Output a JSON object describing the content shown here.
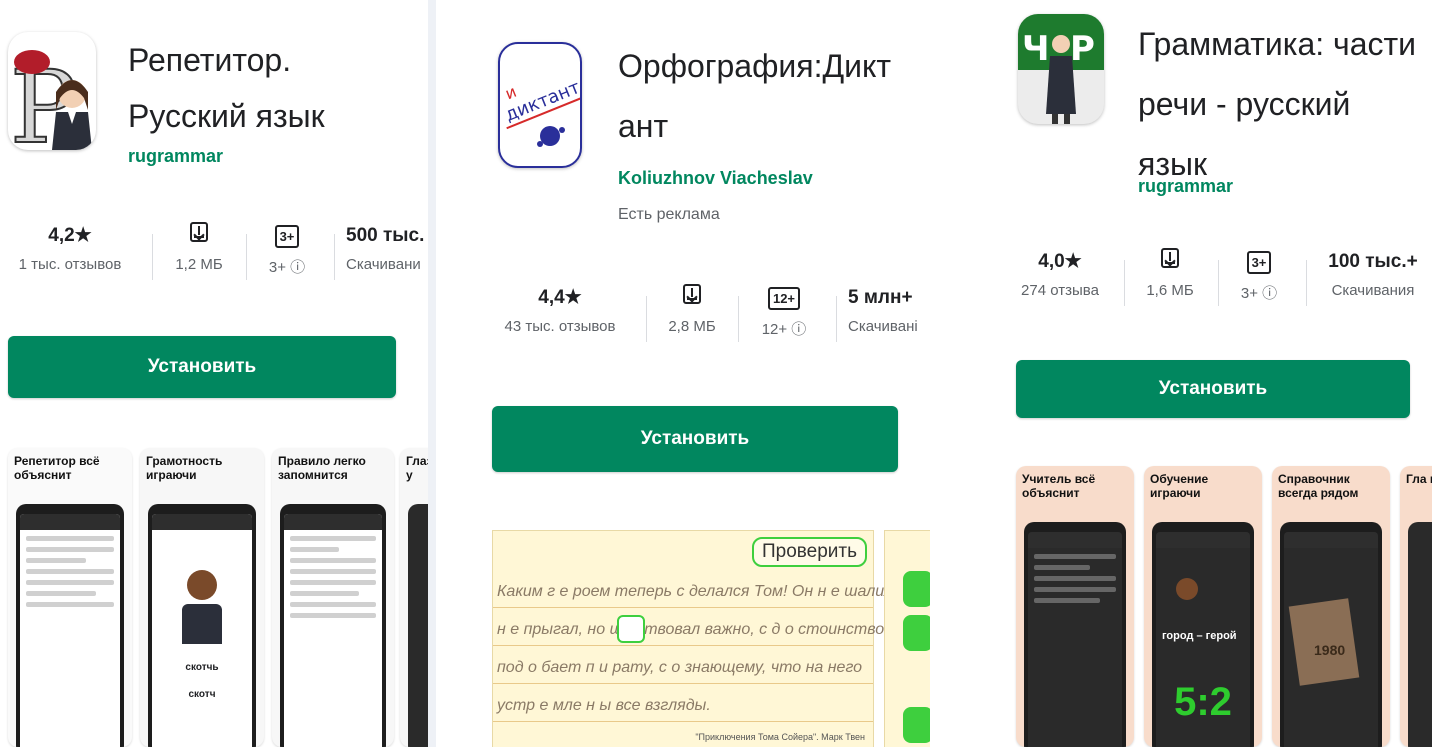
{
  "apps": [
    {
      "title_lines": [
        "Репетитор.",
        "Русский язык"
      ],
      "developer": "rugrammar",
      "rating": "4,2★",
      "reviews": "1 тыс. отзывов",
      "size": "1,2 МБ",
      "age_badge": "3+",
      "age": "3+ ⓘ",
      "downloads": "500 тыс.",
      "downloads_label": "Скачивани",
      "install_label": "Установить",
      "screenshots": [
        {
          "caption": "Репетитор всё объяснит"
        },
        {
          "caption": "Грамотность играючи"
        },
        {
          "caption": "Правило легко запомнится"
        },
        {
          "caption": "Глаз не у"
        }
      ],
      "shot_words": [
        "скотчь",
        "скотч"
      ]
    },
    {
      "title_lines": [
        "Орфография:Дикт",
        "ант"
      ],
      "developer": "Koliuzhnov Viacheslav",
      "ads_note": "Есть реклама",
      "rating": "4,4★",
      "reviews": "43 тыс. отзывов",
      "size": "2,8 МБ",
      "age_badge": "12+",
      "age": "12+ ⓘ",
      "downloads": "5 млн+",
      "downloads_label": "Скачивані",
      "install_label": "Установить",
      "check_label": "Проверить",
      "icon_text": "диктант",
      "dictation_lines": [
        "Каким г е роем теперь  с делался Том! Он н е шалил и",
        "н е прыгал, но ше  ствовал важно, с д о стоинством, как",
        "под о бает п и рату, с о знающему, что на него",
        "устр е мле н ы все взгляды."
      ],
      "quote_source": "\"Приключения Тома Сойера\". Марк Твен"
    },
    {
      "title_lines": [
        "Грамматика: части",
        "речи - русский",
        "язык"
      ],
      "developer": "rugrammar",
      "rating": "4,0★",
      "reviews": "274 отзыва",
      "size": "1,6 МБ",
      "age_badge": "3+",
      "age": "3+ ⓘ",
      "downloads": "100 тыс.+",
      "downloads_label": "Скачивания",
      "install_label": "Установить",
      "icon_letters": [
        "Ч",
        "Р"
      ],
      "screenshots": [
        {
          "caption": "Учитель всё объяснит"
        },
        {
          "caption": "Обучение играючи"
        },
        {
          "caption": "Справочник всегда рядом"
        },
        {
          "caption": "Гла не у"
        }
      ],
      "shot_words": [
        "город – герой",
        "5:2",
        "1980"
      ]
    }
  ],
  "colors": {
    "accent": "#01875f",
    "check_green": "#3ecf3e"
  }
}
